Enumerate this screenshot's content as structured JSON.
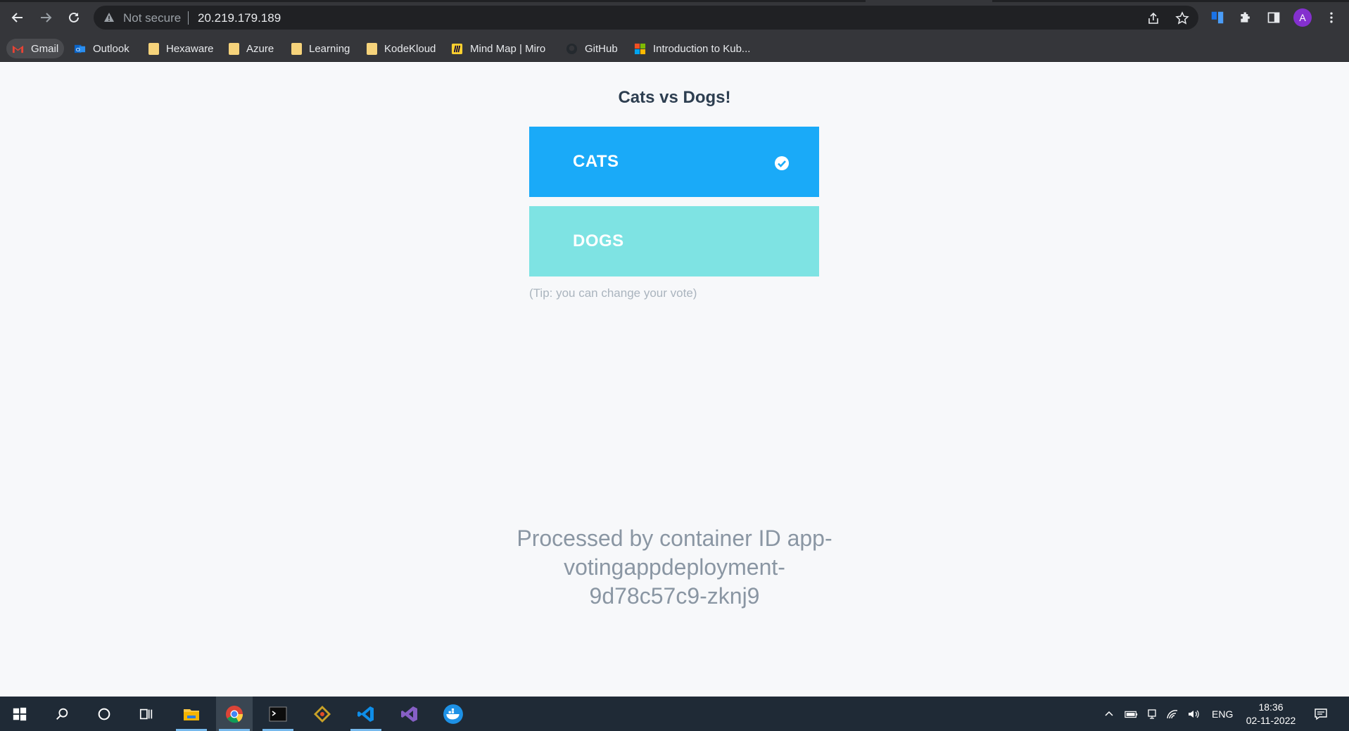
{
  "browser": {
    "security_label": "Not secure",
    "url": "20.219.179.189",
    "profile_initial": "A"
  },
  "bookmarks": [
    {
      "label": "Gmail"
    },
    {
      "label": "Outlook"
    },
    {
      "label": "Hexaware"
    },
    {
      "label": "Azure"
    },
    {
      "label": "Learning"
    },
    {
      "label": "KodeKloud"
    },
    {
      "label": "Mind Map | Miro"
    },
    {
      "label": "GitHub"
    },
    {
      "label": "Introduction to Kub..."
    }
  ],
  "page": {
    "title": "Cats vs Dogs!",
    "option_a": "CATS",
    "option_b": "DOGS",
    "selected": "CATS",
    "tip": "(Tip: you can change your vote)",
    "container_lines": [
      "Processed by container ID app-",
      "votingappdeployment-",
      "9d78c57c9-zknj9"
    ]
  },
  "colors": {
    "cats": "#1aaaf8",
    "dogs": "#7ee3e3",
    "title": "#2d3e50"
  },
  "taskbar": {
    "apps": [
      "start-icon",
      "search-icon",
      "cortana-icon",
      "task-view-icon",
      "file-explorer-icon",
      "chrome-icon",
      "terminal-icon",
      "git-icon",
      "vscode-icon",
      "visual-studio-icon",
      "docker-icon"
    ],
    "lang": "ENG",
    "time": "18:36",
    "date": "02-11-2022"
  }
}
